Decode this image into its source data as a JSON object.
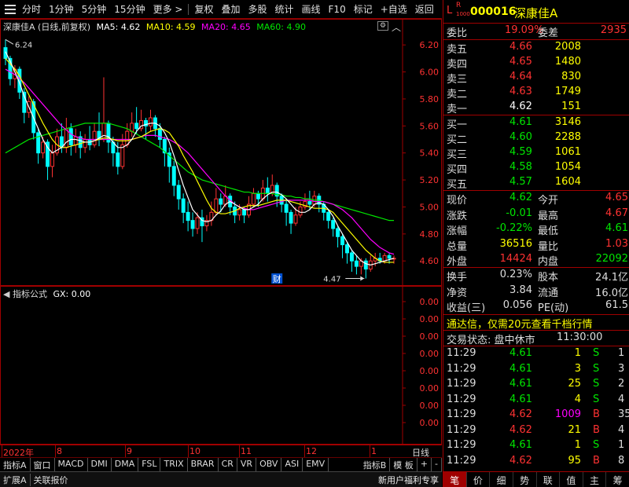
{
  "toolbar": {
    "items": [
      "分时",
      "1分钟",
      "5分钟",
      "15分钟",
      "更多 >",
      "复权",
      "叠加",
      "多股",
      "统计",
      "画线",
      "F10",
      "标记",
      "+自选",
      "返回"
    ]
  },
  "main_chart": {
    "title": "深康佳A (日线,前复权)",
    "ma5": "MA5: 4.62",
    "ma10": "MA10: 4.59",
    "ma20": "MA20: 4.65",
    "ma60": "MA60: 4.90",
    "high_label": "6.24",
    "low_label": "4.47",
    "cai_marker": "财",
    "price_ticks": [
      "6.20",
      "6.00",
      "5.80",
      "5.60",
      "5.40",
      "5.20",
      "5.00",
      "4.80",
      "4.60"
    ],
    "colors": {
      "up": "#ff3232",
      "down": "#00ffff",
      "ma5": "#ffffff",
      "ma10": "#ffff00",
      "ma20": "#ff00ff",
      "ma60": "#00e600",
      "frame": "#a00000"
    }
  },
  "chart_data": {
    "type": "candlestick",
    "x": [
      "2022年",
      "8",
      "9",
      "10",
      "11",
      "12",
      "1"
    ],
    "ylim": [
      4.45,
      6.3
    ],
    "y_ticks": [
      6.2,
      6.0,
      5.8,
      5.6,
      5.4,
      5.2,
      5.0,
      4.8,
      4.6
    ],
    "annotations": {
      "high": 6.24,
      "low": 4.47
    },
    "candles": [
      [
        6.18,
        6.1,
        6.24,
        6.05
      ],
      [
        6.1,
        5.95,
        6.12,
        5.9
      ],
      [
        5.95,
        6.02,
        6.05,
        5.88
      ],
      [
        6.02,
        5.85,
        6.04,
        5.8
      ],
      [
        5.85,
        5.7,
        5.88,
        5.62
      ],
      [
        5.7,
        5.78,
        5.82,
        5.66
      ],
      [
        5.78,
        5.55,
        5.8,
        5.5
      ],
      [
        5.55,
        5.4,
        5.58,
        5.32
      ],
      [
        5.4,
        5.48,
        5.52,
        5.36
      ],
      [
        5.48,
        5.3,
        5.5,
        5.2
      ],
      [
        5.3,
        5.4,
        5.46,
        5.22
      ],
      [
        5.4,
        5.52,
        5.58,
        5.38
      ],
      [
        5.52,
        5.44,
        5.62,
        5.4
      ],
      [
        5.44,
        5.58,
        5.66,
        5.4
      ],
      [
        5.58,
        5.46,
        5.62,
        5.38
      ],
      [
        5.46,
        5.52,
        5.58,
        5.4
      ],
      [
        5.52,
        5.44,
        5.56,
        5.36
      ],
      [
        5.44,
        5.5,
        5.54,
        5.4
      ],
      [
        5.5,
        5.46,
        5.6,
        5.42
      ],
      [
        5.46,
        5.56,
        5.62,
        5.44
      ],
      [
        5.56,
        5.5,
        5.7,
        5.45
      ],
      [
        5.5,
        5.62,
        5.96,
        5.48
      ],
      [
        5.62,
        5.48,
        5.64,
        5.4
      ],
      [
        5.48,
        5.4,
        5.52,
        5.3
      ],
      [
        5.4,
        5.3,
        5.48,
        5.24
      ],
      [
        5.3,
        5.46,
        5.54,
        5.28
      ],
      [
        5.46,
        5.56,
        5.62,
        5.44
      ],
      [
        5.56,
        5.62,
        5.7,
        5.52
      ],
      [
        5.62,
        5.58,
        5.74,
        5.54
      ],
      [
        5.58,
        5.64,
        5.72,
        5.56
      ],
      [
        5.64,
        5.6,
        5.66,
        5.5
      ],
      [
        5.6,
        5.66,
        5.72,
        5.56
      ],
      [
        5.66,
        5.58,
        5.68,
        5.52
      ],
      [
        5.58,
        5.5,
        5.62,
        5.44
      ],
      [
        5.5,
        5.4,
        5.52,
        5.3
      ],
      [
        5.4,
        5.3,
        5.44,
        5.18
      ],
      [
        5.3,
        5.16,
        5.34,
        5.08
      ],
      [
        5.16,
        5.06,
        5.2,
        4.98
      ],
      [
        5.06,
        4.96,
        5.1,
        4.88
      ],
      [
        4.96,
        4.9,
        5.04,
        4.82
      ],
      [
        4.9,
        4.84,
        4.96,
        4.78
      ],
      [
        4.84,
        4.92,
        4.96,
        4.8
      ],
      [
        4.92,
        4.86,
        4.98,
        4.74
      ],
      [
        4.86,
        4.9,
        4.94,
        4.82
      ],
      [
        4.9,
        4.96,
        5.04,
        4.86
      ],
      [
        4.96,
        5.06,
        5.14,
        4.94
      ],
      [
        5.06,
        5.02,
        5.1,
        4.96
      ],
      [
        5.02,
        5.08,
        5.16,
        5.0
      ],
      [
        5.08,
        5.0,
        5.1,
        4.94
      ],
      [
        5.0,
        4.94,
        5.04,
        4.88
      ],
      [
        4.94,
        4.98,
        5.02,
        4.9
      ],
      [
        4.98,
        4.94,
        5.0,
        4.88
      ],
      [
        4.94,
        5.02,
        5.08,
        4.92
      ],
      [
        5.02,
        5.1,
        5.14,
        5.0
      ],
      [
        5.1,
        5.06,
        5.12,
        5.0
      ],
      [
        5.06,
        5.14,
        5.2,
        5.04
      ],
      [
        5.14,
        5.1,
        5.22,
        5.04
      ],
      [
        5.1,
        5.16,
        5.24,
        5.08
      ],
      [
        5.16,
        5.08,
        5.18,
        5.0
      ],
      [
        5.08,
        5.02,
        5.1,
        4.96
      ],
      [
        5.02,
        4.96,
        5.06,
        4.86
      ],
      [
        4.96,
        4.88,
        4.98,
        4.8
      ],
      [
        4.88,
        4.94,
        5.0,
        4.86
      ],
      [
        4.94,
        5.0,
        5.04,
        4.92
      ],
      [
        5.0,
        5.04,
        5.1,
        4.98
      ],
      [
        5.04,
        5.02,
        5.12,
        4.98
      ],
      [
        5.02,
        5.08,
        5.12,
        5.0
      ],
      [
        5.08,
        5.02,
        5.1,
        4.96
      ],
      [
        5.02,
        4.96,
        5.04,
        4.9
      ],
      [
        4.96,
        4.9,
        4.98,
        4.84
      ],
      [
        4.9,
        4.84,
        4.92,
        4.78
      ],
      [
        4.84,
        4.78,
        4.86,
        4.7
      ],
      [
        4.78,
        4.72,
        4.8,
        4.62
      ],
      [
        4.72,
        4.66,
        4.74,
        4.58
      ],
      [
        4.66,
        4.6,
        4.68,
        4.52
      ],
      [
        4.6,
        4.56,
        4.64,
        4.5
      ],
      [
        4.56,
        4.6,
        4.62,
        4.5
      ],
      [
        4.6,
        4.54,
        4.62,
        4.47
      ],
      [
        4.54,
        4.6,
        4.64,
        4.52
      ],
      [
        4.6,
        4.62,
        4.66,
        4.56
      ],
      [
        4.62,
        4.6,
        4.66,
        4.58
      ],
      [
        4.6,
        4.64,
        4.66,
        4.58
      ],
      [
        4.64,
        4.62,
        4.66,
        4.58
      ],
      [
        4.62,
        4.62,
        4.64,
        4.58
      ]
    ],
    "ma5": [
      6.15,
      6.08,
      6.0,
      5.92,
      5.82,
      5.74,
      5.66,
      5.58,
      5.5,
      5.44,
      5.4,
      5.42,
      5.44,
      5.48,
      5.5,
      5.5,
      5.49,
      5.48,
      5.48,
      5.49,
      5.51,
      5.53,
      5.52,
      5.48,
      5.44,
      5.44,
      5.46,
      5.5,
      5.56,
      5.6,
      5.61,
      5.62,
      5.62,
      5.6,
      5.55,
      5.48,
      5.38,
      5.27,
      5.16,
      5.07,
      4.98,
      4.94,
      4.9,
      4.89,
      4.9,
      4.94,
      4.97,
      5.02,
      5.04,
      5.02,
      5.0,
      4.98,
      4.98,
      5.0,
      5.02,
      5.06,
      5.09,
      5.11,
      5.11,
      5.09,
      5.06,
      5.02,
      4.98,
      4.96,
      4.96,
      4.98,
      5.02,
      5.03,
      5.02,
      4.98,
      4.93,
      4.86,
      4.8,
      4.74,
      4.68,
      4.64,
      4.6,
      4.58,
      4.57,
      4.58,
      4.59,
      4.6,
      4.61,
      4.62
    ],
    "ma10": [
      6.1,
      6.06,
      6.02,
      5.97,
      5.9,
      5.83,
      5.76,
      5.69,
      5.62,
      5.56,
      5.5,
      5.46,
      5.44,
      5.44,
      5.45,
      5.46,
      5.47,
      5.48,
      5.48,
      5.49,
      5.5,
      5.51,
      5.51,
      5.5,
      5.49,
      5.49,
      5.49,
      5.5,
      5.51,
      5.52,
      5.54,
      5.56,
      5.57,
      5.58,
      5.57,
      5.55,
      5.5,
      5.45,
      5.38,
      5.32,
      5.26,
      5.19,
      5.12,
      5.05,
      4.99,
      4.96,
      4.95,
      4.95,
      4.96,
      4.97,
      4.99,
      5.0,
      5.01,
      5.01,
      5.01,
      5.02,
      5.03,
      5.04,
      5.05,
      5.05,
      5.05,
      5.04,
      5.03,
      5.02,
      5.01,
      5.0,
      4.99,
      4.99,
      4.99,
      4.98,
      4.96,
      4.92,
      4.88,
      4.84,
      4.8,
      4.76,
      4.72,
      4.68,
      4.65,
      4.62,
      4.6,
      4.59,
      4.59,
      4.59
    ],
    "ma20": [
      6.02,
      6.0,
      5.98,
      5.95,
      5.92,
      5.88,
      5.84,
      5.8,
      5.76,
      5.72,
      5.68,
      5.64,
      5.6,
      5.57,
      5.54,
      5.52,
      5.51,
      5.5,
      5.5,
      5.5,
      5.5,
      5.5,
      5.5,
      5.5,
      5.5,
      5.5,
      5.5,
      5.5,
      5.51,
      5.52,
      5.53,
      5.53,
      5.53,
      5.52,
      5.51,
      5.5,
      5.48,
      5.46,
      5.43,
      5.4,
      5.36,
      5.32,
      5.28,
      5.24,
      5.2,
      5.16,
      5.12,
      5.08,
      5.05,
      5.02,
      5.0,
      4.99,
      4.98,
      4.98,
      4.99,
      5.0,
      5.01,
      5.02,
      5.03,
      5.04,
      5.05,
      5.05,
      5.05,
      5.05,
      5.05,
      5.05,
      5.04,
      5.04,
      5.04,
      5.03,
      5.02,
      5.0,
      4.98,
      4.95,
      4.92,
      4.88,
      4.84,
      4.8,
      4.76,
      4.73,
      4.7,
      4.68,
      4.66,
      4.65
    ],
    "ma60": [
      5.4,
      5.42,
      5.44,
      5.46,
      5.48,
      5.5,
      5.51,
      5.52,
      5.53,
      5.54,
      5.55,
      5.56,
      5.57,
      5.58,
      5.59,
      5.6,
      5.61,
      5.62,
      5.62,
      5.62,
      5.62,
      5.62,
      5.62,
      5.61,
      5.6,
      5.59,
      5.58,
      5.56,
      5.54,
      5.52,
      5.5,
      5.48,
      5.46,
      5.44,
      5.41,
      5.38,
      5.35,
      5.32,
      5.29,
      5.26,
      5.24,
      5.22,
      5.2,
      5.19,
      5.18,
      5.17,
      5.16,
      5.15,
      5.14,
      5.13,
      5.12,
      5.11,
      5.11,
      5.1,
      5.1,
      5.1,
      5.1,
      5.1,
      5.09,
      5.09,
      5.08,
      5.08,
      5.07,
      5.07,
      5.06,
      5.06,
      5.05,
      5.05,
      5.04,
      5.03,
      5.02,
      5.01,
      5.0,
      4.99,
      4.98,
      4.97,
      4.96,
      4.95,
      4.94,
      4.93,
      4.92,
      4.91,
      4.9,
      4.9
    ]
  },
  "indicator_pane": {
    "title": "指标公式",
    "value": "GX: 0.00",
    "ticks": [
      "0.00",
      "0.00",
      "0.00",
      "0.00",
      "0.00",
      "0.00",
      "0.00",
      "0.00"
    ]
  },
  "date_axis": {
    "labels": [
      "2022年",
      "8",
      "9",
      "10",
      "11",
      "12",
      "1"
    ],
    "period": "日线"
  },
  "indicator_tabs": [
    "指标A",
    "窗口",
    "MACD",
    "DMI",
    "DMA",
    "FSL",
    "TRIX",
    "BRAR",
    "CR",
    "VR",
    "OBV",
    "ASI",
    "EMV",
    "指标B",
    "模 板",
    "+",
    "-"
  ],
  "status_bar": {
    "left": [
      "扩展A",
      "关联报价"
    ],
    "right": "新用户福利专享"
  },
  "quote": {
    "code": "000016",
    "name": "深康佳A",
    "flag_l": "L",
    "flag_r": "R",
    "flag_num": "1000",
    "weibi_label": "委比",
    "weibi": "19.09%",
    "weicha_label": "委差",
    "weicha": "2935",
    "asks": [
      {
        "label": "卖五",
        "price": "4.66",
        "vol": "2008"
      },
      {
        "label": "卖四",
        "price": "4.65",
        "vol": "1480"
      },
      {
        "label": "卖三",
        "price": "4.64",
        "vol": "830"
      },
      {
        "label": "卖二",
        "price": "4.63",
        "vol": "1749"
      },
      {
        "label": "卖一",
        "price": "4.62",
        "vol": "151"
      }
    ],
    "bids": [
      {
        "label": "买一",
        "price": "4.61",
        "vol": "3146"
      },
      {
        "label": "买二",
        "price": "4.60",
        "vol": "2288"
      },
      {
        "label": "买三",
        "price": "4.59",
        "vol": "1061"
      },
      {
        "label": "买四",
        "price": "4.58",
        "vol": "1054"
      },
      {
        "label": "买五",
        "price": "4.57",
        "vol": "1604"
      }
    ],
    "stats": [
      {
        "l1": "现价",
        "v1": "4.62",
        "l2": "今开",
        "v2": "4.65"
      },
      {
        "l1": "涨跌",
        "v1": "-0.01",
        "l2": "最高",
        "v2": "4.67"
      },
      {
        "l1": "涨幅",
        "v1": "-0.22%",
        "l2": "最低",
        "v2": "4.61"
      },
      {
        "l1": "总量",
        "v1": "36516",
        "l2": "量比",
        "v2": "1.03"
      },
      {
        "l1": "外盘",
        "v1": "14424",
        "l2": "内盘",
        "v2": "22092"
      }
    ],
    "fund": [
      {
        "l1": "换手",
        "v1": "0.23%",
        "l2": "股本",
        "v2": "24.1亿"
      },
      {
        "l1": "净资",
        "v1": "3.84",
        "l2": "流通",
        "v2": "16.0亿"
      },
      {
        "l1": "收益(三)",
        "v1": "0.056",
        "l2": "PE(动)",
        "v2": "61.5"
      }
    ],
    "promo": "通达信，仅需20元查看千档行情",
    "trade_status_label": "交易状态: 盘中休市",
    "trade_status_time": "11:30:00",
    "ticks": [
      {
        "time": "11:29",
        "price": "4.61",
        "vol": "1",
        "side": "S",
        "num": "1"
      },
      {
        "time": "11:29",
        "price": "4.61",
        "vol": "3",
        "side": "S",
        "num": "3"
      },
      {
        "time": "11:29",
        "price": "4.61",
        "vol": "25",
        "side": "S",
        "num": "2"
      },
      {
        "time": "11:29",
        "price": "4.61",
        "vol": "4",
        "side": "S",
        "num": "4"
      },
      {
        "time": "11:29",
        "price": "4.62",
        "vol": "1009",
        "side": "B",
        "num": "35"
      },
      {
        "time": "11:29",
        "price": "4.62",
        "vol": "21",
        "side": "B",
        "num": "4"
      },
      {
        "time": "11:29",
        "price": "4.61",
        "vol": "1",
        "side": "S",
        "num": "1"
      },
      {
        "time": "11:29",
        "price": "4.62",
        "vol": "95",
        "side": "B",
        "num": "8"
      }
    ]
  },
  "bottom_tabs": [
    "笔",
    "价",
    "细",
    "势",
    "联",
    "值",
    "主",
    "筹"
  ]
}
